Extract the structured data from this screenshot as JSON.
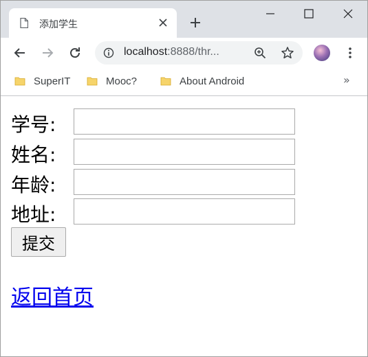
{
  "browser": {
    "tab": {
      "title": "添加学生",
      "icon": "page-icon"
    },
    "omnibox": {
      "host": "localhost",
      "rest": ":8888/thr..."
    },
    "bookmarks": [
      {
        "label": "SuperIT",
        "icon": "folder-icon"
      },
      {
        "label": "Mooc?",
        "icon": "folder-icon"
      },
      {
        "label": "About Android",
        "icon": "folder-icon"
      }
    ],
    "bookmarks_overflow": "»"
  },
  "form": {
    "fields": [
      {
        "label": "学号:",
        "value": ""
      },
      {
        "label": "姓名:",
        "value": ""
      },
      {
        "label": "年龄:",
        "value": ""
      },
      {
        "label": "地址:",
        "value": ""
      }
    ],
    "submit_label": "提交"
  },
  "back_link": "返回首页",
  "colors": {
    "link": "#0000ee",
    "titlebar": "#dee1e6",
    "folder": "#f6d46b"
  }
}
